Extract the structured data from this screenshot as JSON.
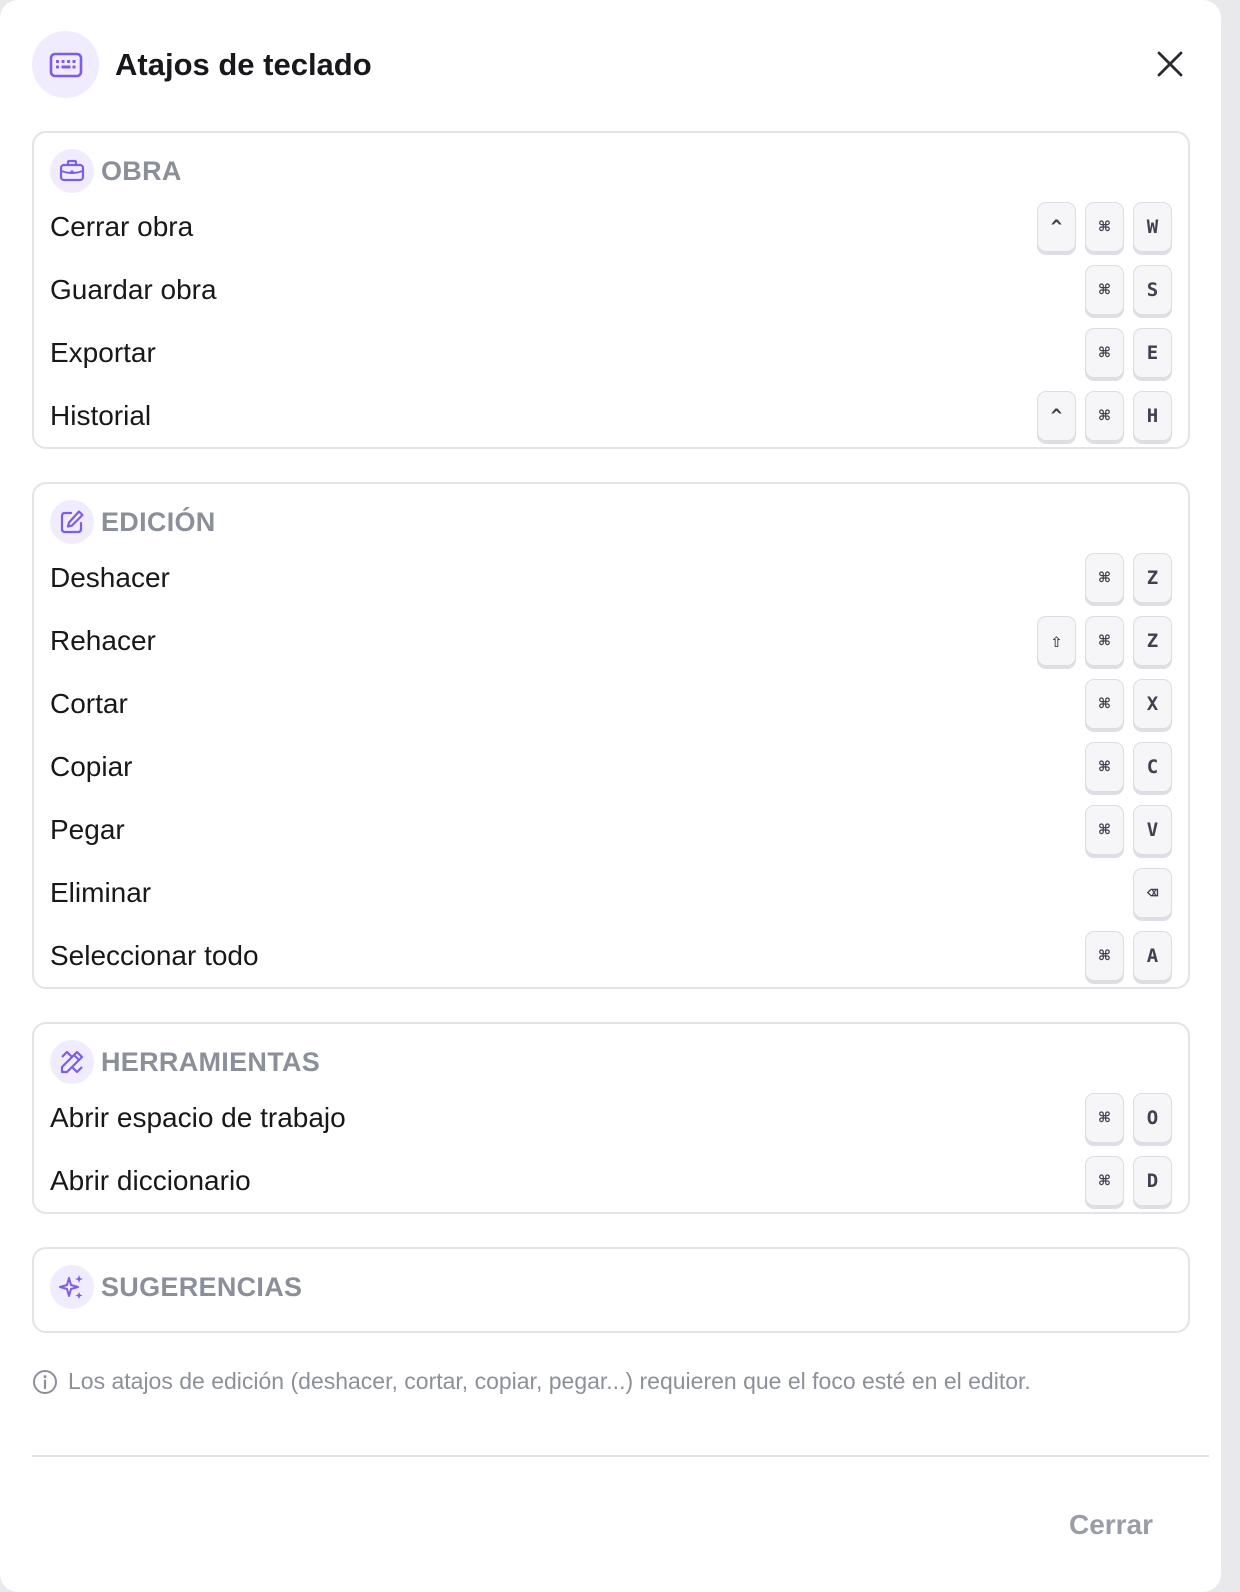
{
  "dialog": {
    "title": "Atajos de teclado",
    "header_icon": "keyboard-icon",
    "close_icon": "close-icon"
  },
  "sections": [
    {
      "id": "obra",
      "title": "OBRA",
      "icon": "briefcase-icon",
      "items": [
        {
          "label": "Cerrar obra",
          "keys": [
            "^",
            "⌘",
            "W"
          ]
        },
        {
          "label": "Guardar obra",
          "keys": [
            "⌘",
            "S"
          ]
        },
        {
          "label": "Exportar",
          "keys": [
            "⌘",
            "E"
          ]
        },
        {
          "label": "Historial",
          "keys": [
            "^",
            "⌘",
            "H"
          ]
        }
      ]
    },
    {
      "id": "edicion",
      "title": "EDICIÓN",
      "icon": "edit-icon",
      "items": [
        {
          "label": "Deshacer",
          "keys": [
            "⌘",
            "Z"
          ]
        },
        {
          "label": "Rehacer",
          "keys": [
            "⇧",
            "⌘",
            "Z"
          ]
        },
        {
          "label": "Cortar",
          "keys": [
            "⌘",
            "X"
          ]
        },
        {
          "label": "Copiar",
          "keys": [
            "⌘",
            "C"
          ]
        },
        {
          "label": "Pegar",
          "keys": [
            "⌘",
            "V"
          ]
        },
        {
          "label": "Eliminar",
          "keys": [
            "⌫"
          ]
        },
        {
          "label": "Seleccionar todo",
          "keys": [
            "⌘",
            "A"
          ]
        }
      ]
    },
    {
      "id": "herramientas",
      "title": "HERRAMIENTAS",
      "icon": "tools-icon",
      "items": [
        {
          "label": "Abrir espacio de trabajo",
          "keys": [
            "⌘",
            "O"
          ]
        },
        {
          "label": "Abrir diccionario",
          "keys": [
            "⌘",
            "D"
          ]
        }
      ]
    },
    {
      "id": "sugerencias",
      "title": "SUGERENCIAS",
      "icon": "sparkles-icon",
      "items": []
    }
  ],
  "footer": {
    "note": "Los atajos de edición (deshacer, cortar, copiar, pegar...) requieren que el foco esté en el editor.",
    "note_icon": "info-icon",
    "close_label": "Cerrar"
  },
  "colors": {
    "accent": "#7c5ce8",
    "accent_bg": "#f0ecfd",
    "section_title": "#8b8f99"
  }
}
